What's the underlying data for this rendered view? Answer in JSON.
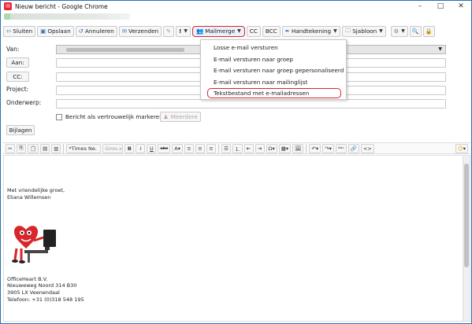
{
  "window": {
    "title": "Nieuw bericht - Google Chrome",
    "minimize": "–",
    "maximize": "□",
    "close": "✕"
  },
  "toolbar": {
    "sluiten": "Sluiten",
    "opslaan": "Opslaan",
    "annuleren": "Annuleren",
    "verzenden": "Verzenden",
    "priority": "!",
    "mailmerge": "Mailmerge",
    "cc": "CC",
    "bcc": "BCC",
    "handtekening": "Handtekening",
    "sjabloon": "Sjabloon"
  },
  "form": {
    "van_label": "Van:",
    "aan_button": "Aan:",
    "cc_button": "CC:",
    "project_label": "Project:",
    "onderwerp_label": "Onderwerp:",
    "confidential_label": "Bericht als vertrouwelijk markeren",
    "meerdere": "Meerdere",
    "bijlagen": "Bijlagen"
  },
  "mailmerge_menu": {
    "items": [
      "Losse e-mail versturen",
      "E-mail versturen naar groep",
      "E-mail versturen naar groep gepersonaliseerd",
      "E-mail versturen naar mailinglijst",
      "Tekstbestand met e-mailadressen"
    ],
    "highlighted_index": 4
  },
  "editor_toolbar": {
    "font": "*Times Ne.",
    "size": "Groo.x",
    "bold": "B",
    "italic": "I",
    "underline": "U",
    "strike": "abc",
    "color": "A",
    "omega": "Ω"
  },
  "body": {
    "greeting": "Met vriendelijke groet,",
    "name": "Eliana Willemsen",
    "company": "OfficeHeart B.V.",
    "street": "Nieuweweg Noord 314 B30",
    "city": "3905 LX Veenendaal",
    "phone": "Telefoon: +31 (0)318 548 195"
  },
  "colors": {
    "accent_red": "#d8262a",
    "chrome_blue": "#2b6fb3"
  }
}
